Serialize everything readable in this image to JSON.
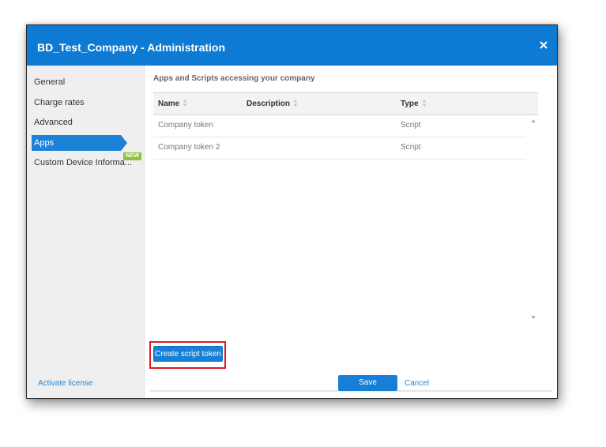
{
  "dialog": {
    "title": "BD_Test_Company - Administration",
    "close_icon": "close-icon"
  },
  "sidebar": {
    "items": [
      {
        "label": "General"
      },
      {
        "label": "Charge rates"
      },
      {
        "label": "Advanced"
      },
      {
        "label": "Apps",
        "active": true
      },
      {
        "label": "Custom Device Informa...",
        "badge": "NEW"
      }
    ]
  },
  "main": {
    "section_title": "Apps and Scripts accessing your company",
    "table": {
      "columns": [
        "Name",
        "Description",
        "Type"
      ],
      "rows": [
        {
          "name": "Company token",
          "description": "",
          "type": "Script"
        },
        {
          "name": "Company token 2",
          "description": "",
          "type": "Script"
        }
      ]
    },
    "create_button": "Create script token"
  },
  "footer": {
    "activate_link": "Activate license",
    "save_button": "Save",
    "cancel_link": "Cancel"
  },
  "colors": {
    "accent": "#0d7ad3",
    "highlight_border": "#e01b24",
    "badge": "#8cc43f",
    "link": "#2a86d1"
  }
}
